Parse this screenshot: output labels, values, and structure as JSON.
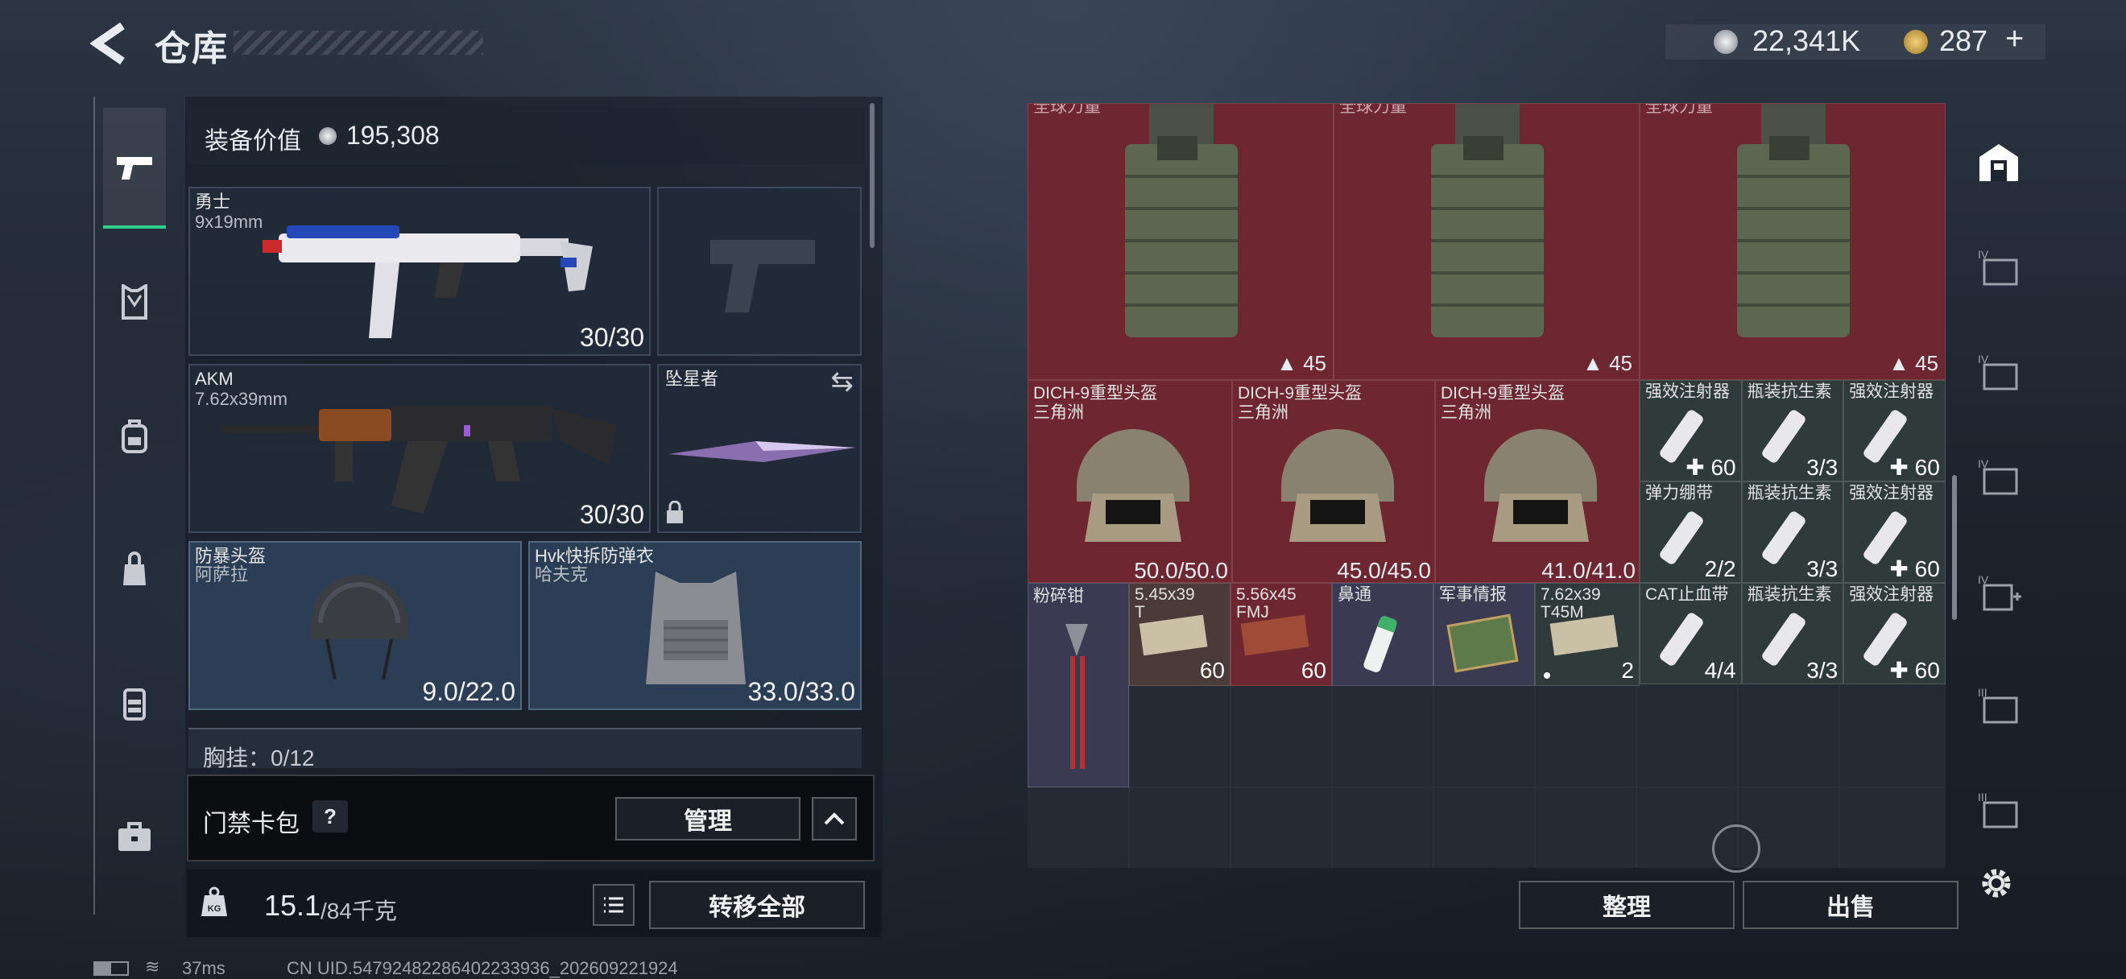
{
  "header": {
    "title": "仓库",
    "currency_silver": "22,341K",
    "currency_gold": "287",
    "gold_plus": "+"
  },
  "sidebar": {
    "tabs": [
      "weapons",
      "armor",
      "backpack",
      "bag",
      "vest",
      "case"
    ]
  },
  "gear": {
    "value_label": "装备价值",
    "value": "195,308",
    "primary": {
      "name": "勇士",
      "ammo": "9x19mm",
      "durability": "30/30"
    },
    "secondary": {
      "name": "AKM",
      "ammo": "7.62x39mm",
      "durability": "30/30"
    },
    "melee": {
      "name": "坠星者"
    },
    "helmet": {
      "name": "防暴头盔",
      "sub": "阿萨拉",
      "durability": "9.0/22.0"
    },
    "armor": {
      "name": "Hvk快拆防弹衣",
      "sub": "哈夫克",
      "durability": "33.0/33.0"
    },
    "chest_rig": "胸挂：0/12"
  },
  "keycard": {
    "label": "门禁卡包",
    "help": "?",
    "manage": "管理"
  },
  "weight": {
    "current": "15.1",
    "max": "/84千克",
    "transfer_all": "转移全部"
  },
  "stash": {
    "top_row": [
      {
        "label": "全球力量",
        "count": "45"
      },
      {
        "label": "全球力量",
        "count": "45"
      },
      {
        "label": "全球力量",
        "count": "45"
      }
    ],
    "helmets": [
      {
        "name": "DICH-9重型头盔",
        "sub": "三角洲",
        "durability": "50.0/50.0"
      },
      {
        "name": "DICH-9重型头盔",
        "sub": "三角洲",
        "durability": "45.0/45.0"
      },
      {
        "name": "DICH-9重型头盔",
        "sub": "三角洲",
        "durability": "41.0/41.0"
      }
    ],
    "meds": [
      {
        "name": "强效注射器",
        "count": "60",
        "plus": true
      },
      {
        "name": "瓶装抗生素",
        "count": "3/3"
      },
      {
        "name": "强效注射器",
        "count": "60",
        "plus": true
      },
      {
        "name": "弹力绷带",
        "count": "2/2"
      },
      {
        "name": "瓶装抗生素",
        "count": "3/3"
      },
      {
        "name": "强效注射器",
        "count": "60",
        "plus": true
      },
      {
        "name": "CAT止血带",
        "count": "4/4"
      },
      {
        "name": "瓶装抗生素",
        "count": "3/3"
      },
      {
        "name": "强效注射器",
        "count": "60",
        "plus": true
      }
    ],
    "misc": [
      {
        "name": "粉碎钳",
        "count": ""
      },
      {
        "name": "5.45x39",
        "sub": "T",
        "count": "60"
      },
      {
        "name": "5.56x45",
        "sub": "FMJ",
        "count": "60"
      },
      {
        "name": "鼻通",
        "count": ""
      },
      {
        "name": "军事情报",
        "count": ""
      },
      {
        "name": "7.62x39",
        "sub": "T45M",
        "count": "2"
      }
    ],
    "sort": "整理",
    "sell": "出售"
  },
  "footer": {
    "ping": "37ms",
    "uid": "CN UID.54792482286402233936_202609221924"
  },
  "colors": {
    "accent_green": "#2fd08a",
    "red_cell": "#6e2731"
  }
}
